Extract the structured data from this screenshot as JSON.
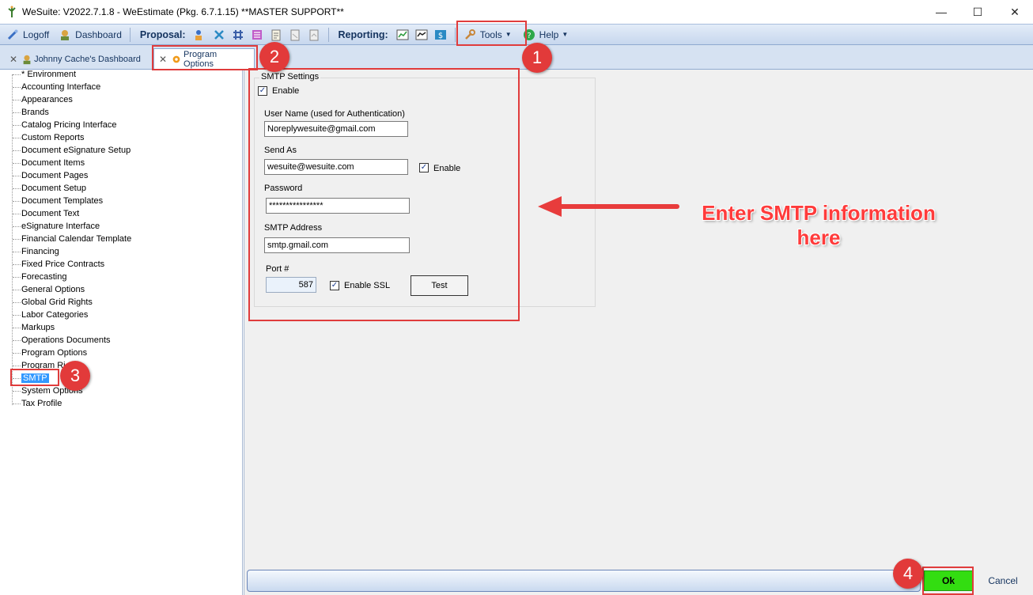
{
  "window": {
    "title": "WeSuite: V2022.7.1.8 - WeEstimate (Pkg. 6.7.1.15) **MASTER SUPPORT**",
    "minimize_glyph": "—",
    "maximize_glyph": "☐",
    "close_glyph": "✕"
  },
  "toolbar": {
    "logoff_label": "Logoff",
    "dashboard_label": "Dashboard",
    "proposal_label": "Proposal:",
    "reporting_label": "Reporting:",
    "tools_label": "Tools",
    "help_label": "Help"
  },
  "tabs": [
    {
      "label": "Johnny Cache's Dashboard",
      "close": "✕"
    },
    {
      "label": "Program Options",
      "close": "✕"
    }
  ],
  "tree": {
    "items": [
      "* Environment",
      "Accounting Interface",
      "Appearances",
      "Brands",
      "Catalog Pricing Interface",
      "Custom Reports",
      "Document eSignature Setup",
      "Document Items",
      "Document Pages",
      "Document Setup",
      "Document Templates",
      "Document Text",
      "eSignature Interface",
      "Financial Calendar Template",
      "Financing",
      "Fixed Price Contracts",
      "Forecasting",
      "General Options",
      "Global Grid Rights",
      "Labor Categories",
      "Markups",
      "Operations Documents",
      "Program Options",
      "Program Ri",
      "SMTP",
      "System Options",
      "Tax Profile"
    ],
    "selected": "SMTP"
  },
  "smtp": {
    "group_title": "SMTP Settings",
    "enable_label": "Enable",
    "username_label": "User Name (used for Authentication)",
    "username_value": "Noreplywesuite@gmail.com",
    "sendas_label": "Send As",
    "sendas_value": "wesuite@wesuite.com",
    "sendas_enable_label": "Enable",
    "password_label": "Password",
    "password_value": "****************",
    "address_label": "SMTP Address",
    "address_value": "smtp.gmail.com",
    "port_label": "Port #",
    "port_value": "587",
    "ssl_label": "Enable SSL",
    "test_label": "Test",
    "check_glyph": "✓"
  },
  "footer": {
    "ok_label": "Ok",
    "cancel_label": "Cancel"
  },
  "annotations": {
    "step1": "1",
    "step2": "2",
    "step3": "3",
    "step4": "4",
    "callout_line1": "Enter SMTP information",
    "callout_line2": "here"
  },
  "colors": {
    "annotation_red": "#e03c3c",
    "ok_green": "#33dd11",
    "selection_blue": "#3399ff"
  }
}
